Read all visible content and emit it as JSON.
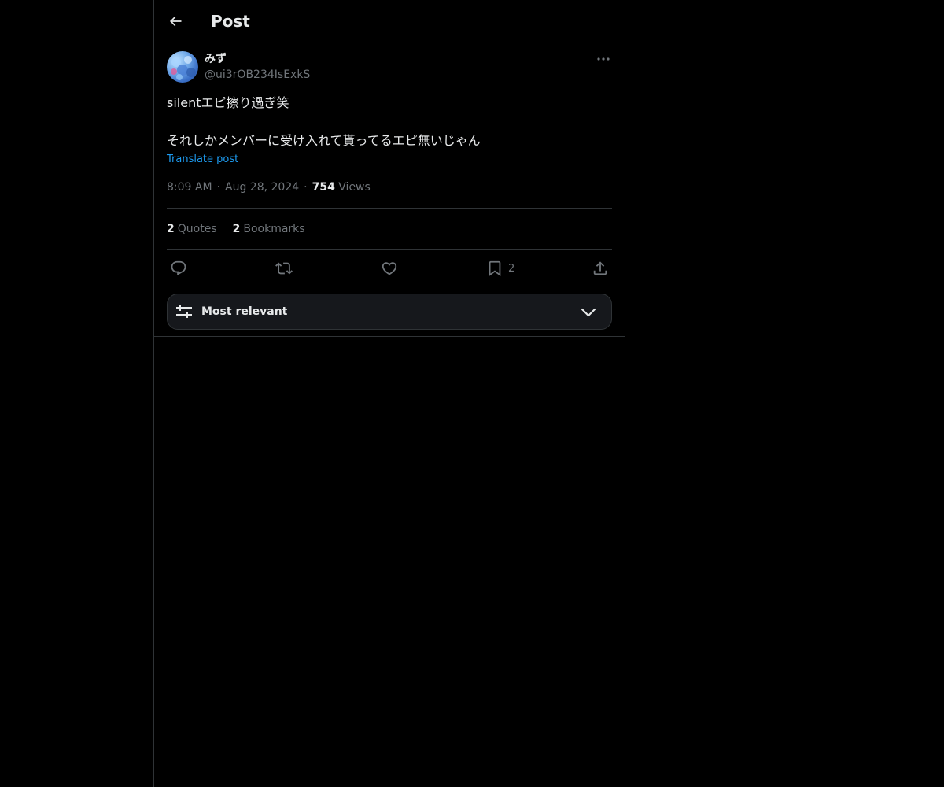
{
  "header": {
    "title": "Post",
    "back_icon": "arrow-left-icon"
  },
  "post": {
    "author": {
      "name": "みず",
      "handle": "@ui3rOB234IsExkS"
    },
    "text": "silentエピ擦り過ぎ笑\n\nそれしかメンバーに受け入れて貰ってるエピ無いじゃん",
    "translate_label": "Translate post",
    "time": "8:09 AM",
    "separator": "·",
    "date": "Aug 28, 2024",
    "views_count": "754",
    "views_label": "Views"
  },
  "stats": {
    "quotes_count": "2",
    "quotes_label": "Quotes",
    "bookmarks_count": "2",
    "bookmarks_label": "Bookmarks"
  },
  "actions": {
    "reply_icon": "reply-icon",
    "repost_icon": "repost-icon",
    "like_icon": "heart-icon",
    "bookmark_icon": "bookmark-icon",
    "bookmark_count": "2",
    "share_icon": "share-icon"
  },
  "replies_sort": {
    "label": "Most relevant",
    "icon": "sliders-icon",
    "chevron": "chevron-down-icon"
  },
  "colors": {
    "background": "#000000",
    "text_primary": "#e7e9ea",
    "text_secondary": "#71767b",
    "link": "#1d9bf0",
    "border": "#2f3336"
  }
}
